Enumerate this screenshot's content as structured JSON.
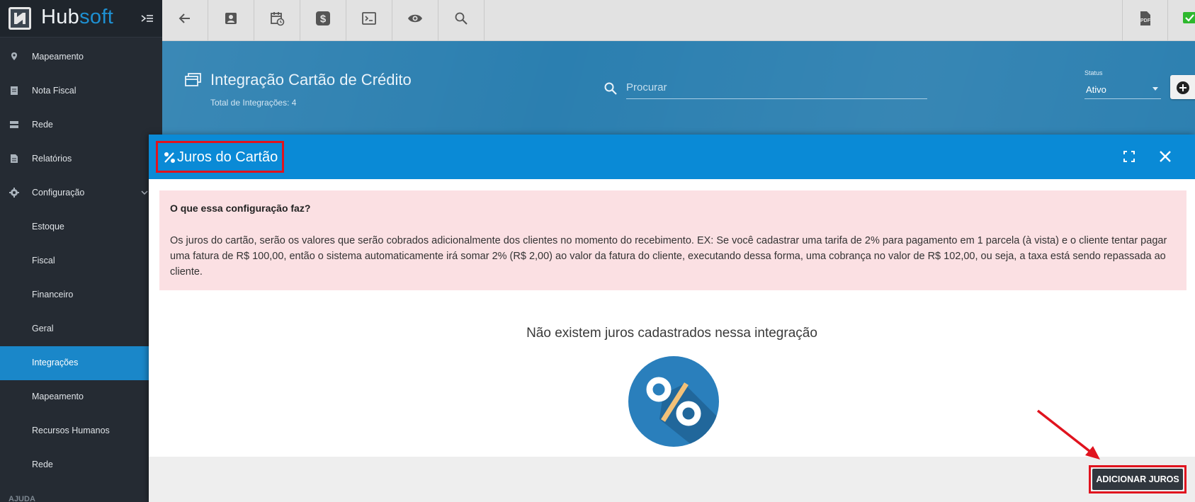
{
  "app": {
    "logo_part1": "Hub",
    "logo_part2": "soft"
  },
  "sidebar": {
    "items": [
      {
        "label": "Mapeamento",
        "icon": "map-pin-icon"
      },
      {
        "label": "Nota Fiscal",
        "icon": "document-icon"
      },
      {
        "label": "Rede",
        "icon": "server-icon"
      },
      {
        "label": "Relatórios",
        "icon": "report-icon"
      },
      {
        "label": "Configuração",
        "icon": "gear-icon"
      }
    ],
    "sub_items": [
      {
        "label": "Estoque"
      },
      {
        "label": "Fiscal"
      },
      {
        "label": "Financeiro"
      },
      {
        "label": "Geral"
      },
      {
        "label": "Integrações",
        "active": true
      },
      {
        "label": "Mapeamento"
      },
      {
        "label": "Recursos Humanos"
      },
      {
        "label": "Rede"
      }
    ],
    "help_label": "AJUDA"
  },
  "toolbar": {
    "buttons": [
      "back-arrow-icon",
      "contact-card-icon",
      "calendar-clock-icon",
      "dollar-icon",
      "terminal-icon",
      "eye-icon",
      "search-icon",
      "pdf-icon",
      "check-icon"
    ]
  },
  "header": {
    "title": "Integração Cartão de Crédito",
    "subtitle": "Total de Integrações: 4",
    "search_placeholder": "Procurar",
    "status_label": "Status",
    "status_value": "Ativo"
  },
  "modal": {
    "title": "Juros do Cartão",
    "info_title": "O que essa configuração faz?",
    "info_text": "Os juros do cartão, serão os valores que serão cobrados adicionalmente dos clientes no momento do recebimento. EX: Se você cadastrar uma tarifa de 2% para pagamento em 1 parcela (à vista) e o cliente tentar pagar uma fatura de R$ 100,00, então o sistema automaticamente irá somar 2% (R$ 2,00) ao valor da fatura do cliente, executando dessa forma, uma cobrança no valor de R$ 102,00, ou seja, a taxa está sendo repassada ao cliente.",
    "empty_message": "Não existem juros cadastrados nessa integração",
    "add_button": "ADICIONAR JUROS"
  },
  "colors": {
    "sidebar_bg": "#252b33",
    "active_item": "#1a87c9",
    "header_bg": "#2b7fb0",
    "modal_header": "#0a8ad6",
    "info_bg": "#fbe0e3",
    "highlight_red": "#e0131e",
    "button_dark": "#31373e"
  }
}
